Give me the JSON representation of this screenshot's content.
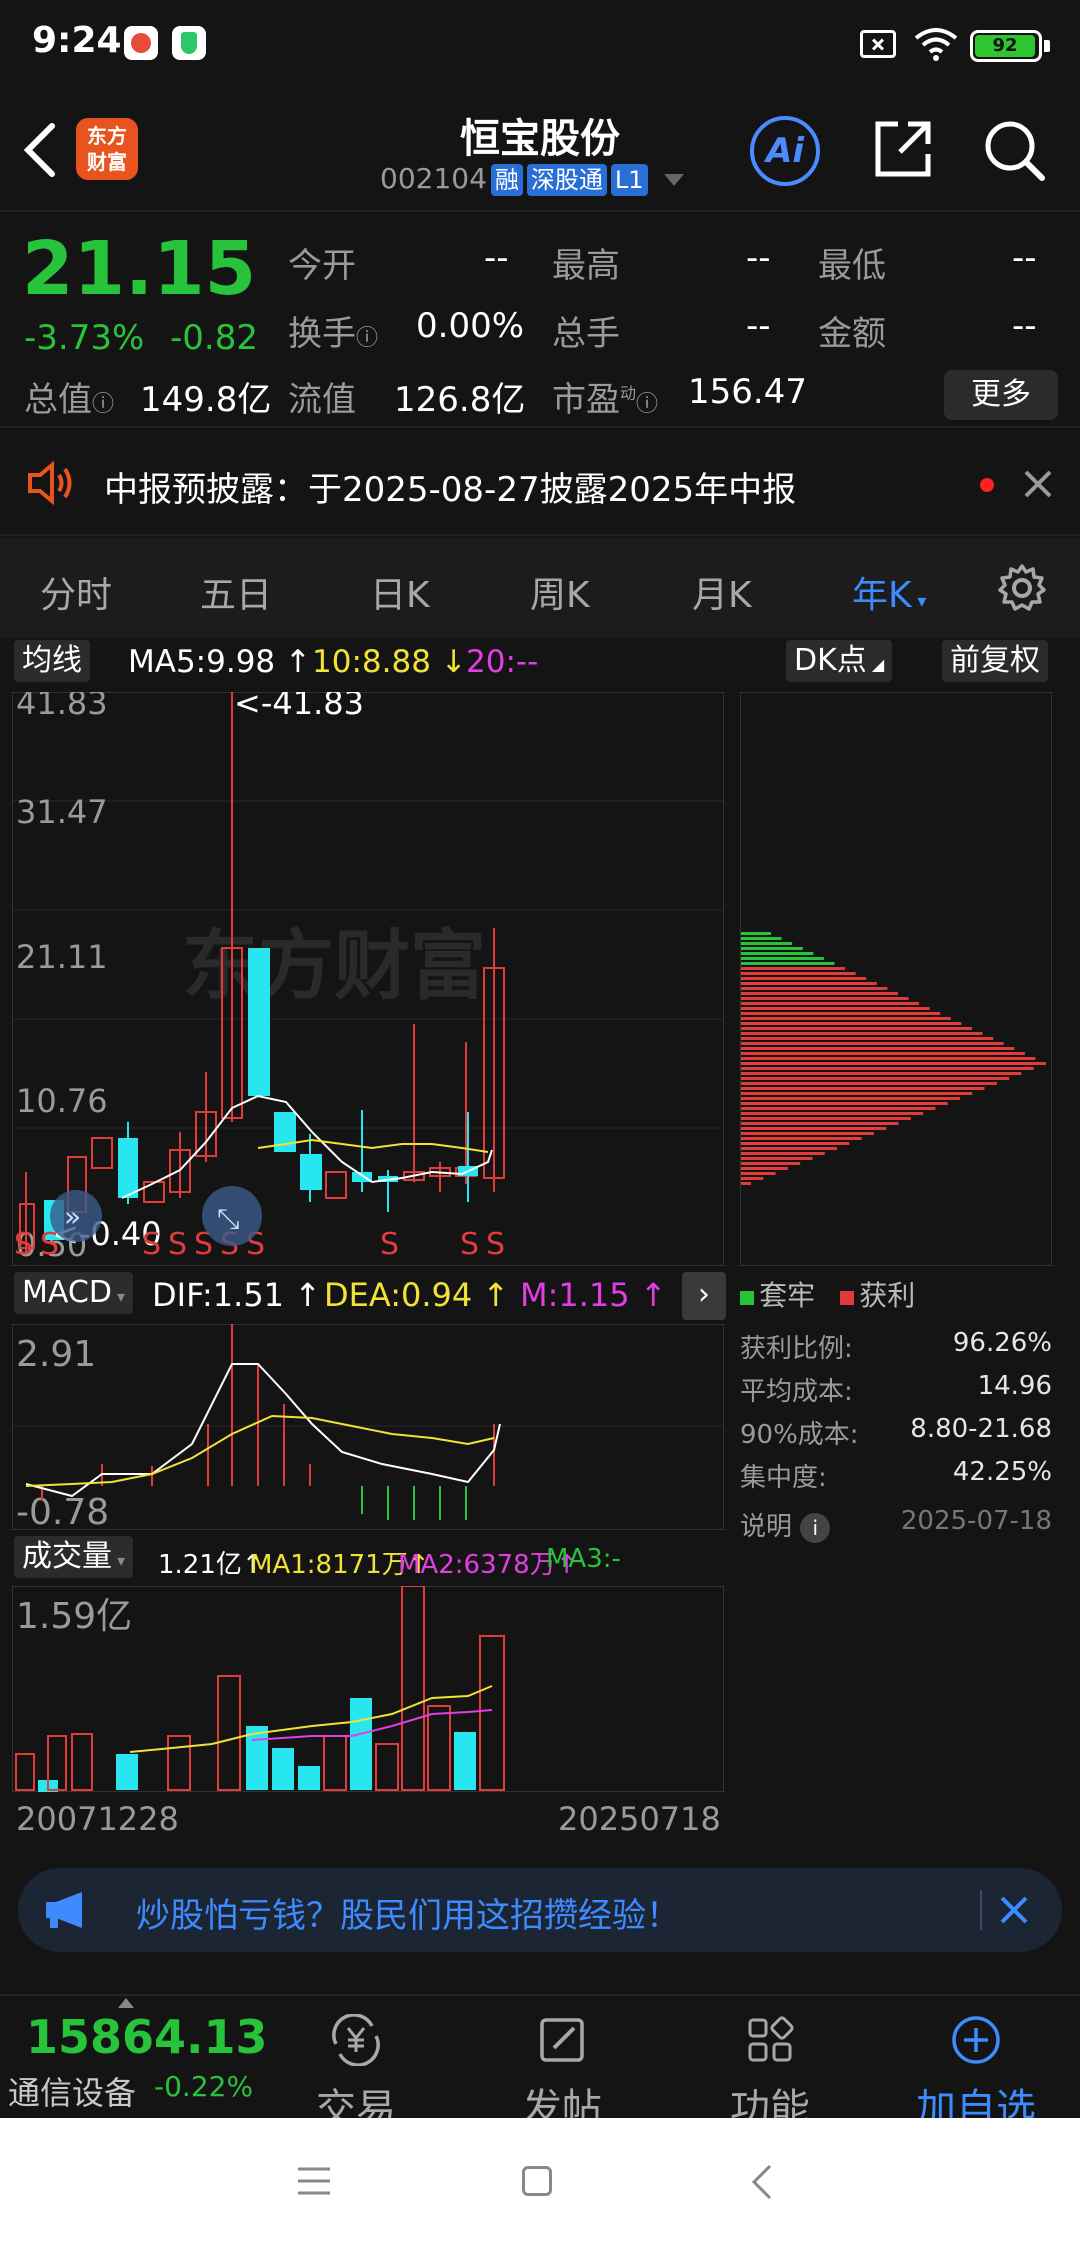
{
  "status": {
    "time": "9:24",
    "battery": "92"
  },
  "header": {
    "logo_text_1": "东方",
    "logo_text_2": "财富",
    "title": "恒宝股份",
    "code": "002104",
    "tags": [
      "融",
      "深股通",
      "L1"
    ],
    "ai_label": "Ai"
  },
  "quote": {
    "price": "21.15",
    "change_pct": "-3.73%",
    "change": "-0.82",
    "open_label": "今开",
    "open": "--",
    "high_label": "最高",
    "high": "--",
    "low_label": "最低",
    "low": "--",
    "turnover_label": "换手",
    "turnover": "0.00%",
    "volume_label": "总手",
    "volume": "--",
    "amount_label": "金额",
    "amount": "--",
    "mktcap_label": "总值",
    "mktcap": "149.8亿",
    "float_label": "流值",
    "float": "126.8亿",
    "pe_label": "市盈",
    "pe_sup": "动",
    "pe": "156.47",
    "more_label": "更多"
  },
  "notice": {
    "text": "中报预披露：于2025-08-27披露2025年中报"
  },
  "tabs": [
    "分时",
    "五日",
    "日K",
    "周K",
    "月K",
    "年K"
  ],
  "active_tab": "年K",
  "ma_bar": {
    "chip": "均线",
    "ma5": "MA5:9.98",
    "ma10": "10:8.88",
    "ma20": "20:--",
    "dk_chip": "DK点",
    "adjust_chip": "前复权"
  },
  "kline": {
    "y_labels": [
      "41.83",
      "31.47",
      "21.11",
      "10.76",
      "0.50"
    ],
    "max_marker": "<-41.83",
    "min_marker": "<-0.40",
    "s_markers": [
      "S",
      "S",
      "S",
      "S",
      "S",
      "S",
      "S",
      "S",
      "S",
      "S"
    ],
    "watermark": "东方财富"
  },
  "chip_panel": {
    "legend_trapped": "套牢",
    "legend_profit": "获利",
    "rows": [
      {
        "label": "获利比例:",
        "value": "96.26%"
      },
      {
        "label": "平均成本:",
        "value": "14.96"
      },
      {
        "label": "90%成本:",
        "value": "8.80-21.68"
      },
      {
        "label": "集中度:",
        "value": "42.25%"
      }
    ],
    "note_label": "说明",
    "date": "2025-07-18"
  },
  "macd": {
    "chip": "MACD",
    "dif": "DIF:1.51",
    "dea": "DEA:0.94",
    "m": "M:1.15",
    "y_top": "2.91",
    "y_bottom": "-0.78"
  },
  "volume": {
    "chip": "成交量",
    "vol": "1.21亿",
    "ma1": "MA1:8171万",
    "ma2": "MA2:6378万",
    "ma3": "MA3:-",
    "y_top": "1.59亿",
    "x_start": "20071228",
    "x_end": "20250718"
  },
  "ad": {
    "text": "炒股怕亏钱？股民们用这招攒经验！"
  },
  "bottom": {
    "index_value": "15864.13",
    "index_name": "通信设备",
    "index_change": "-0.22%",
    "nav": [
      "交易",
      "发帖",
      "功能",
      "加自选"
    ]
  },
  "colors": {
    "up": "#e03c3c",
    "down": "#27c43b",
    "accent": "#3d8bff",
    "cyan": "#27e6f0"
  }
}
